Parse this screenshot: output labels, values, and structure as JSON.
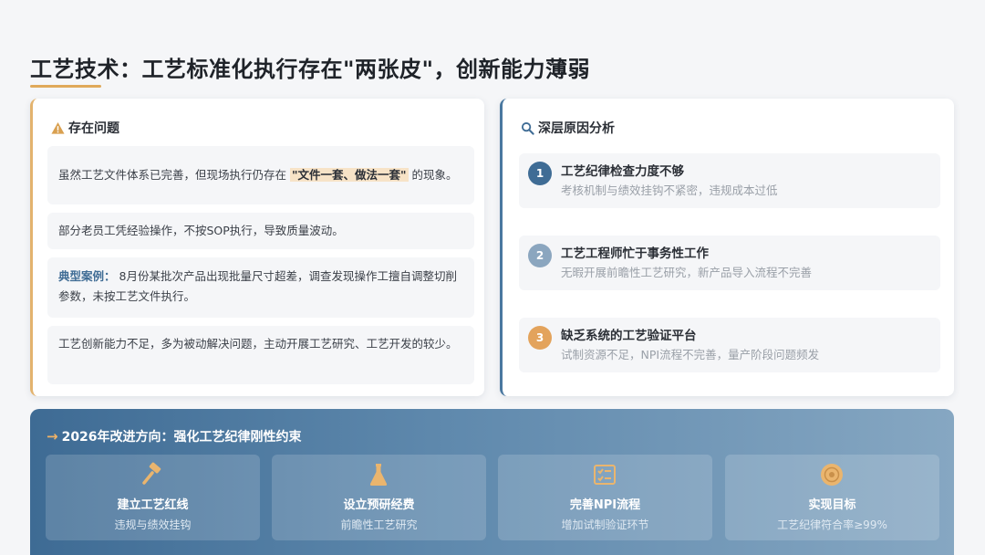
{
  "title": "工艺技术：工艺标准化执行存在\"两张皮\"，创新能力薄弱",
  "problems": {
    "heading": "存在问题",
    "item1_pre": "虽然工艺文件体系已完善，但现场执行仍存在 ",
    "item1_hl": "\"文件一套、做法一套\"",
    "item1_post": " 的现象。",
    "item2": "部分老员工凭经验操作，不按SOP执行，导致质量波动。",
    "case_label": "典型案例：",
    "case_text": " 8月份某批次产品出现批量尺寸超差，调查发现操作工擅自调整切削参数，未按工艺文件执行。",
    "item4": "工艺创新能力不足，多为被动解决问题，主动开展工艺研究、工艺开发的较少。",
    "accent": "#e3b36e"
  },
  "causes": {
    "heading": "深层原因分析",
    "items": [
      {
        "num": "1",
        "title": "工艺纪律检查力度不够",
        "desc": "考核机制与绩效挂钩不紧密，违规成本过低",
        "color": "#3f6c95"
      },
      {
        "num": "2",
        "title": "工艺工程师忙于事务性工作",
        "desc": "无暇开展前瞻性工艺研究，新产品导入流程不完善",
        "color": "#8ba6bf"
      },
      {
        "num": "3",
        "title": "缺乏系统的工艺验证平台",
        "desc": "试制资源不足，NPI流程不完善，量产阶段问题频发",
        "color": "#e3a35c"
      }
    ]
  },
  "direction": {
    "heading": "2026年改进方向：强化工艺纪律刚性约束",
    "actions": [
      {
        "icon": "gavel-icon",
        "title": "建立工艺红线",
        "desc": "违规与绩效挂钩"
      },
      {
        "icon": "flask-icon",
        "title": "设立预研经费",
        "desc": "前瞻性工艺研究"
      },
      {
        "icon": "checklist-icon",
        "title": "完善NPI流程",
        "desc": "增加试制验证环节"
      },
      {
        "icon": "target-icon",
        "title": "实现目标",
        "desc": "工艺纪律符合率≥99%"
      }
    ]
  }
}
